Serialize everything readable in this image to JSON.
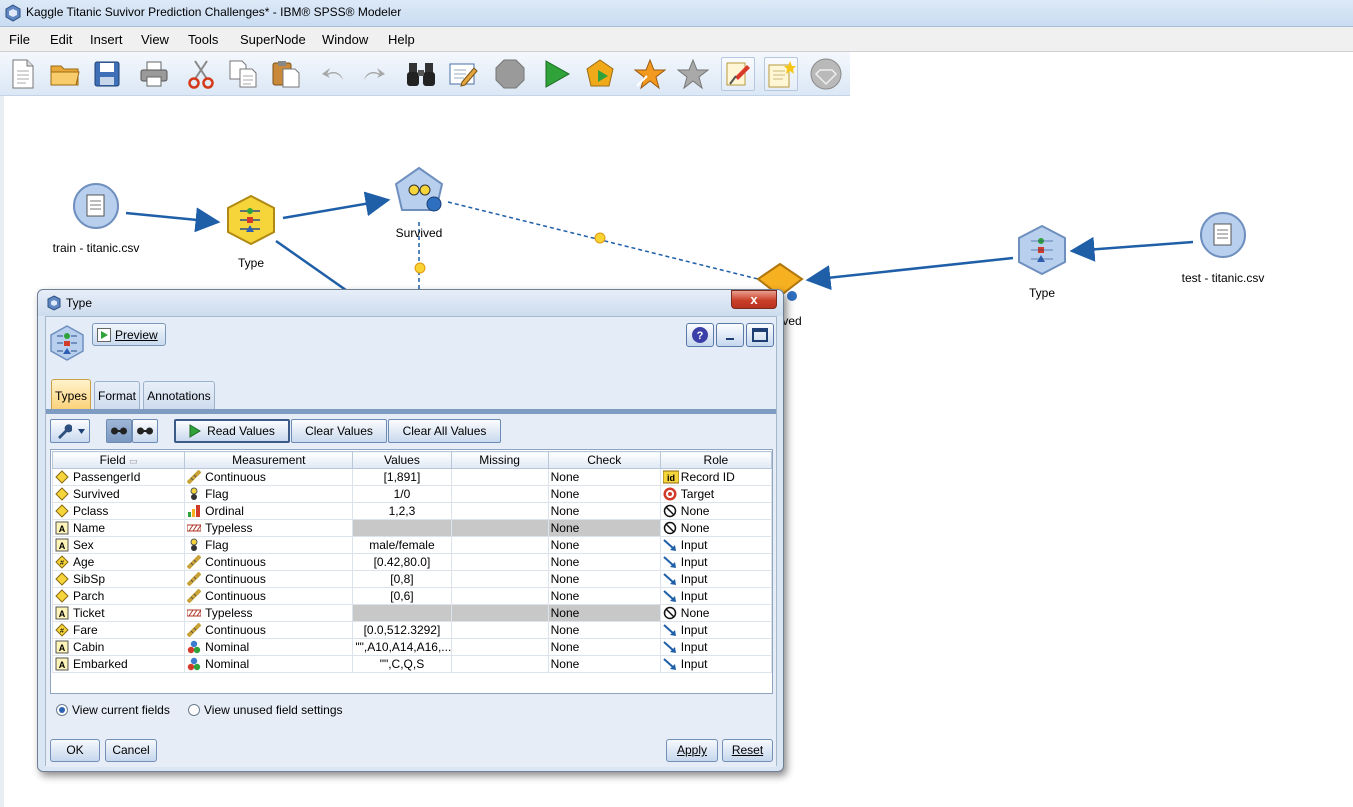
{
  "window": {
    "title": "Kaggle Titanic Suvivor Prediction Challenges* - IBM® SPSS® Modeler"
  },
  "menu": [
    "File",
    "Edit",
    "Insert",
    "View",
    "Tools",
    "SuperNode",
    "Window",
    "Help"
  ],
  "toolbar": [
    "new-file-icon",
    "open-folder-icon",
    "save-icon",
    "print-icon",
    "cut-icon",
    "copy-icon",
    "paste-icon",
    "undo-icon",
    "redo-icon",
    "binoculars-icon",
    "annotate-icon",
    "stop-icon",
    "run-icon",
    "run-selection-icon",
    "star-icon",
    "star-grey-icon",
    "pin-icon",
    "note-icon",
    "gem-icon"
  ],
  "canvas": {
    "nodes": {
      "train_csv": "train - titanic.csv",
      "type_left": "Type",
      "survived_model": "Survived",
      "survived_nugget_partial": "ved",
      "type_right": "Type",
      "test_csv": "test - titanic.csv"
    }
  },
  "dialog": {
    "title": "Type",
    "close_label": "x",
    "preview_label": "Preview",
    "tabs": [
      "Types",
      "Format",
      "Annotations"
    ],
    "active_tab": "Types",
    "buttons": {
      "read_values": "Read Values",
      "clear_values": "Clear Values",
      "clear_all_values": "Clear All Values"
    },
    "table": {
      "columns": [
        "Field",
        "Measurement",
        "Values",
        "Missing",
        "Check",
        "Role"
      ],
      "rows": [
        {
          "field": "PassengerId",
          "measurement": "Continuous",
          "values": "[1,891]",
          "missing": "",
          "check": "None",
          "role": "Record ID"
        },
        {
          "field": "Survived",
          "measurement": "Flag",
          "values": "1/0",
          "missing": "",
          "check": "None",
          "role": "Target"
        },
        {
          "field": "Pclass",
          "measurement": "Ordinal",
          "values": "1,2,3",
          "missing": "",
          "check": "None",
          "role": "None"
        },
        {
          "field": "Name",
          "measurement": "Typeless",
          "values": "",
          "missing": "",
          "check": "None",
          "role": "None"
        },
        {
          "field": "Sex",
          "measurement": "Flag",
          "values": "male/female",
          "missing": "",
          "check": "None",
          "role": "Input"
        },
        {
          "field": "Age",
          "measurement": "Continuous",
          "values": "[0.42,80.0]",
          "missing": "",
          "check": "None",
          "role": "Input"
        },
        {
          "field": "SibSp",
          "measurement": "Continuous",
          "values": "[0,8]",
          "missing": "",
          "check": "None",
          "role": "Input"
        },
        {
          "field": "Parch",
          "measurement": "Continuous",
          "values": "[0,6]",
          "missing": "",
          "check": "None",
          "role": "Input"
        },
        {
          "field": "Ticket",
          "measurement": "Typeless",
          "values": "",
          "missing": "",
          "check": "None",
          "role": "None"
        },
        {
          "field": "Fare",
          "measurement": "Continuous",
          "values": "[0.0,512.3292]",
          "missing": "",
          "check": "None",
          "role": "Input"
        },
        {
          "field": "Cabin",
          "measurement": "Nominal",
          "values": "\"\",A10,A14,A16,...",
          "missing": "",
          "check": "None",
          "role": "Input"
        },
        {
          "field": "Embarked",
          "measurement": "Nominal",
          "values": "\"\",C,Q,S",
          "missing": "",
          "check": "None",
          "role": "Input"
        }
      ]
    },
    "radios": {
      "current_fields": "View current fields",
      "unused_fields": "View unused field settings",
      "selected": "current_fields"
    },
    "footer": {
      "ok": "OK",
      "cancel": "Cancel",
      "apply": "Apply",
      "reset": "Reset"
    }
  }
}
